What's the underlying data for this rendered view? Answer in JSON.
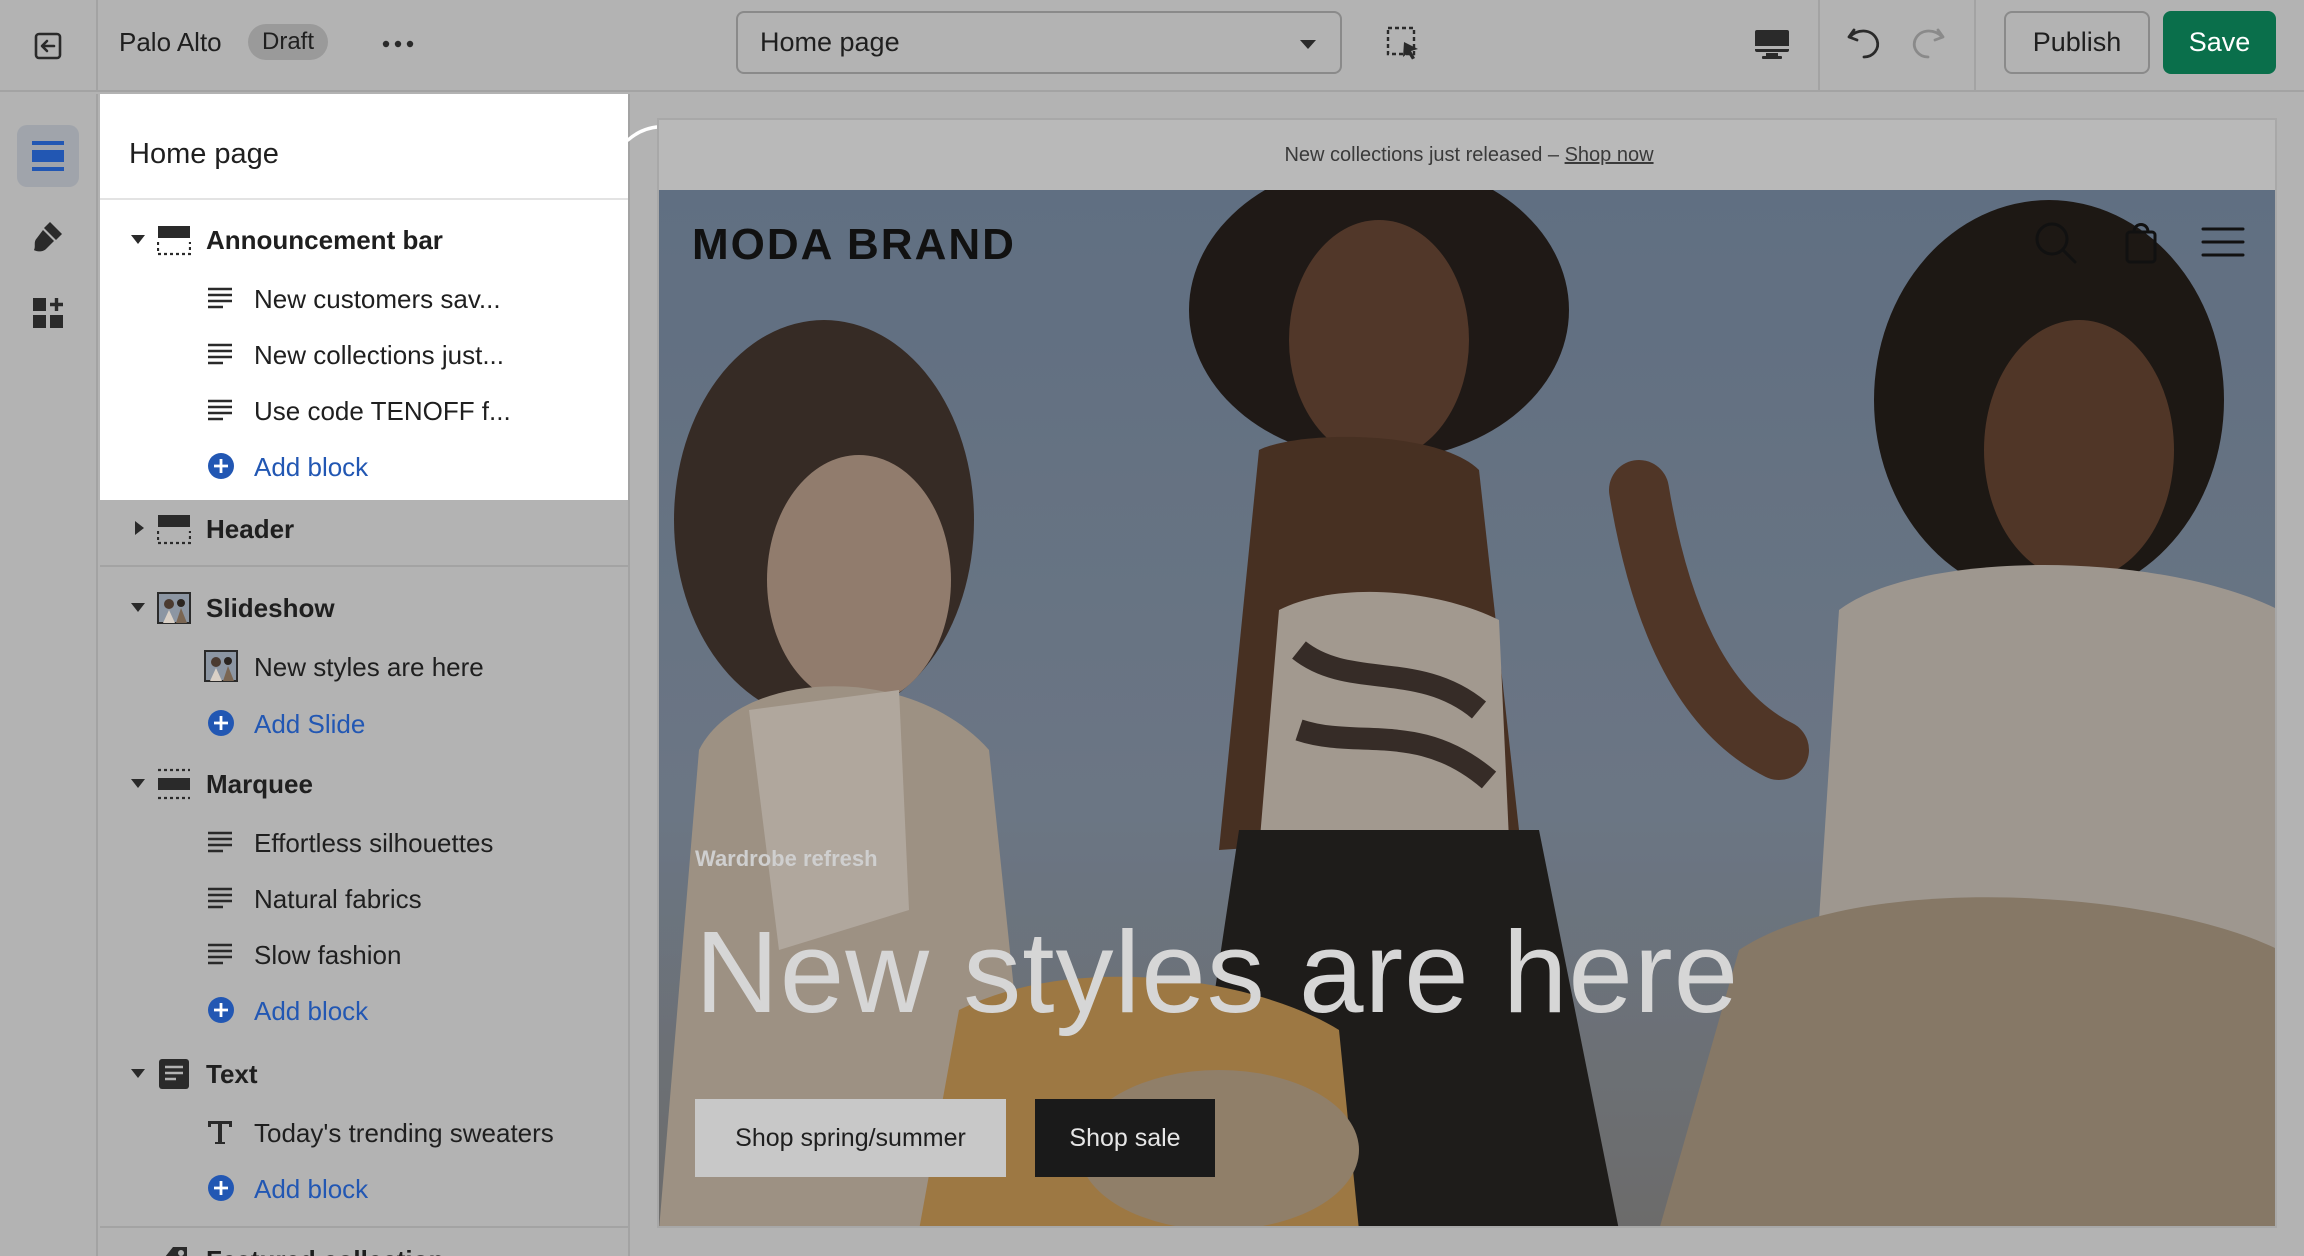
{
  "topbar": {
    "store_name": "Palo Alto",
    "status_badge": "Draft",
    "page_selector": "Home page",
    "publish_label": "Publish",
    "save_label": "Save"
  },
  "rail": {
    "items": [
      "sections-icon",
      "theme-settings-icon",
      "apps-icon"
    ]
  },
  "panel": {
    "title": "Home page",
    "sections": [
      {
        "label": "Announcement bar",
        "icon": "announcement-bar-icon",
        "expanded": true,
        "blocks": [
          "New customers sav...",
          "New collections just...",
          "Use code TENOFF f..."
        ],
        "add_label": "Add block"
      },
      {
        "label": "Header",
        "icon": "header-icon",
        "expanded": false
      },
      {
        "label": "Slideshow",
        "icon": "slideshow-thumbnail-icon",
        "expanded": true,
        "blocks": [
          "New styles are here"
        ],
        "add_label": "Add Slide"
      },
      {
        "label": "Marquee",
        "icon": "marquee-icon",
        "expanded": true,
        "blocks": [
          "Effortless silhouettes",
          "Natural fabrics",
          "Slow fashion"
        ],
        "add_label": "Add block"
      },
      {
        "label": "Text",
        "icon": "text-section-icon",
        "expanded": true,
        "blocks": [
          "Today's trending sweaters"
        ],
        "add_label": "Add block"
      },
      {
        "label": "Featured collection",
        "icon": "tag-icon",
        "expanded": false
      }
    ]
  },
  "preview": {
    "announcement_text": "New collections just released – ",
    "announcement_link": "Shop now",
    "brand": "MODA BRAND",
    "eyebrow": "Wardrobe refresh",
    "headline": "New styles are here",
    "button_primary": "Shop spring/summer",
    "button_secondary": "Shop sale"
  },
  "colors": {
    "save_button": "#0a6f4b",
    "link_blue": "#2257b3",
    "highlight_panel": "#ffffff",
    "overlay_gray": "#b3b3b3"
  }
}
